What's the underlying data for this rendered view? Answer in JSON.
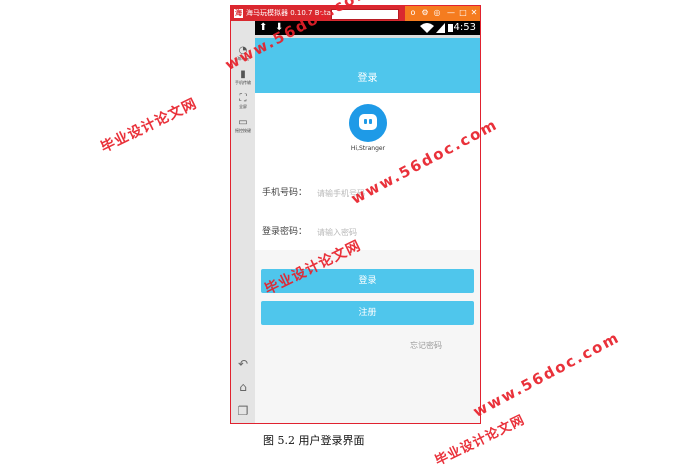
{
  "emulator": {
    "title": "海马玩模拟器 0.10.7 Beta",
    "logo_char": "海",
    "controls": [
      "o",
      "⚙",
      "◎",
      "—",
      "□",
      "✕"
    ],
    "sidebar": [
      {
        "icon": "◔",
        "label": "海马玩"
      },
      {
        "icon": "▮",
        "label": "手机传输"
      },
      {
        "icon": "⛶",
        "label": "全屏"
      },
      {
        "icon": "▭",
        "label": "摇控按键"
      }
    ],
    "nav": {
      "back": "↶",
      "home": "⌂",
      "recent": "❐"
    }
  },
  "statusbar": {
    "icons": [
      "⬆",
      "⬇"
    ],
    "time": "4:53"
  },
  "app": {
    "title": "登录",
    "logo_text": "Hi,Stranger",
    "phone_label": "手机号码：",
    "phone_placeholder": "请输手机号码",
    "password_label": "登录密码：",
    "password_placeholder": "请输入密码",
    "login_button": "登录",
    "register_button": "注册",
    "forgot_link": "忘记密码"
  },
  "watermarks": {
    "site": "www.56doc.com",
    "school": "毕业设计论文网"
  },
  "caption": "图 5.2 用户登录界面",
  "colors": {
    "accent": "#4fc6ec",
    "titlebar": "#d9292f",
    "controls": "#f57c1f",
    "logo": "#1e9ae7",
    "watermark": "#e8202a"
  }
}
